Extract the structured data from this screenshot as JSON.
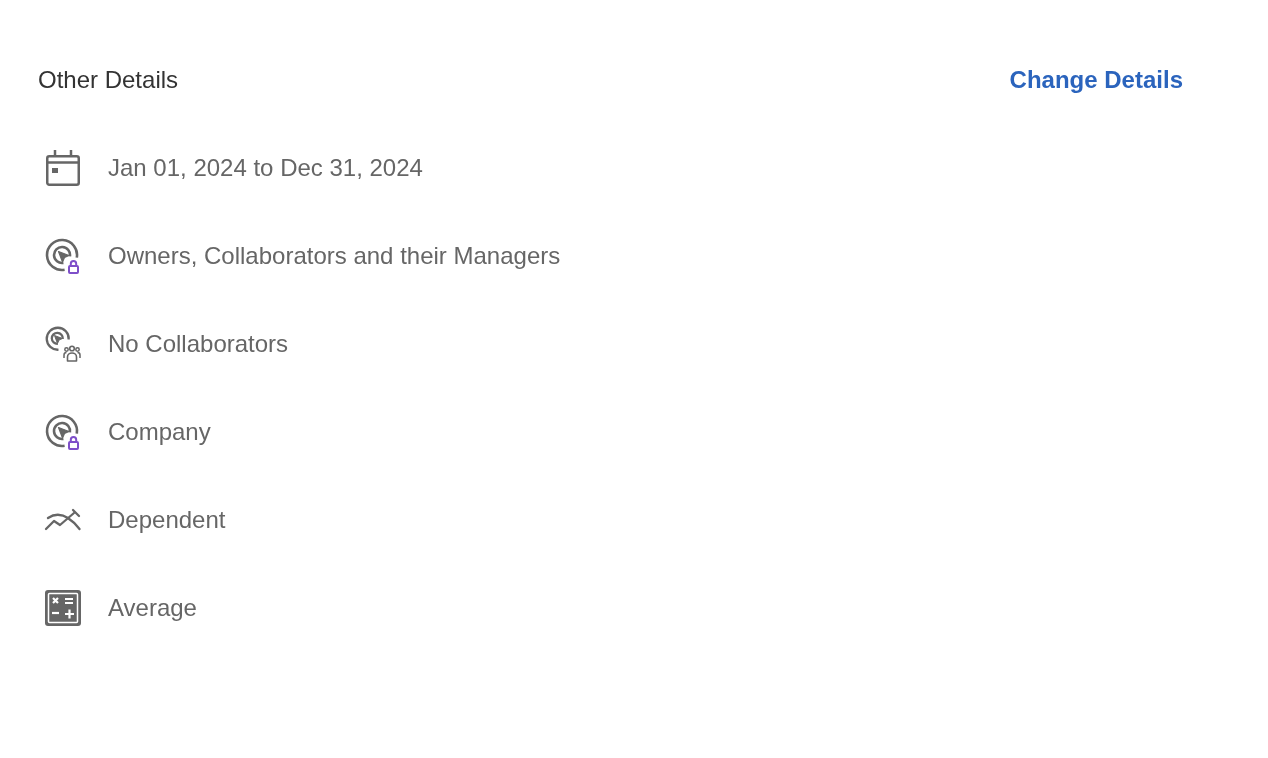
{
  "header": {
    "title": "Other Details",
    "action": "Change Details"
  },
  "details": [
    {
      "kind": "period",
      "text": "Jan 01, 2024 to Dec 31, 2024"
    },
    {
      "kind": "visibility",
      "text": "Owners, Collaborators and their Managers"
    },
    {
      "kind": "collaborators",
      "text": "No Collaborators"
    },
    {
      "kind": "visibility",
      "text": "Company"
    },
    {
      "kind": "progress",
      "text": "Dependent"
    },
    {
      "kind": "calculation",
      "text": "Average"
    }
  ]
}
